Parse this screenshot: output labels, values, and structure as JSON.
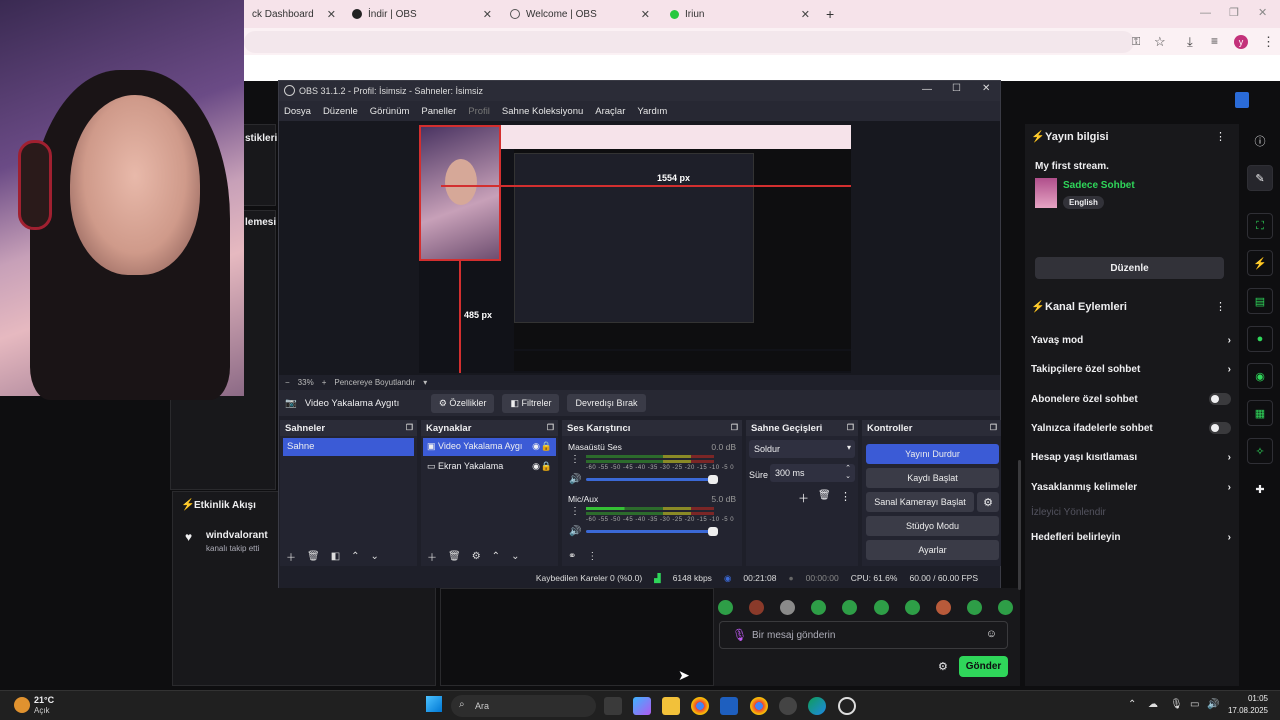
{
  "browser": {
    "tabs": [
      {
        "label": "ck Dashboard"
      },
      {
        "label": "İndir | OBS"
      },
      {
        "label": "Welcome | OBS"
      },
      {
        "label": "Iriun"
      }
    ],
    "new_tab": "+",
    "profile_initial": "y"
  },
  "twitch": {
    "left_headers": [
      "stikleri",
      "lemesi"
    ],
    "event_feed": {
      "title": "Etkinlik Akışı",
      "item_user": "windvalorant",
      "item_text": "kanalı takip etti"
    },
    "stream_info": {
      "title": "Yayın bilgisi",
      "stream_name": "My first stream.",
      "category": "Sadece Sohbet",
      "tag": "English",
      "edit_button": "Düzenle"
    },
    "channel_actions": {
      "title": "Kanal Eylemleri",
      "items": [
        {
          "label": "Yavaş mod",
          "control": "arrow"
        },
        {
          "label": "Takipçilere özel sohbet",
          "control": "arrow"
        },
        {
          "label": "Abonelere özel sohbet",
          "control": "toggle"
        },
        {
          "label": "Yalnızca ifadelerle sohbet",
          "control": "toggle"
        },
        {
          "label": "Hesap yaşı kısıtlaması",
          "control": "arrow"
        },
        {
          "label": "Yasaklanmış kelimeler",
          "control": "arrow"
        },
        {
          "label": "İzleyici Yönlendir",
          "control": "none"
        },
        {
          "label": "Hedefleri belirleyin",
          "control": "arrow"
        }
      ]
    },
    "chat": {
      "placeholder": "Bir mesaj gönderin",
      "send": "Gönder"
    }
  },
  "obs": {
    "title": "OBS 31.1.2 - Profil: İsimsiz - Sahneler: İsimsiz",
    "menu": [
      "Dosya",
      "Düzenle",
      "Görünüm",
      "Paneller",
      "Profil",
      "Sahne Koleksiyonu",
      "Araçlar",
      "Yardım"
    ],
    "preview": {
      "width_label": "1554 px",
      "height_label": "485 px"
    },
    "zoom": {
      "minus": "−",
      "value": "33%",
      "plus": "+",
      "fit": "Pencereye Boyutlandır"
    },
    "source_bar": {
      "source": "Video Yakalama Aygıtı",
      "properties": "Özellikler",
      "filters": "Filtreler",
      "deactivate": "Devredışı Bırak"
    },
    "scenes": {
      "title": "Sahneler",
      "items": [
        "Sahne"
      ]
    },
    "sources": {
      "title": "Kaynaklar",
      "items": [
        "Video Yakalama Aygı",
        "Ekran Yakalama"
      ]
    },
    "mixer": {
      "title": "Ses Karıştırıcı",
      "tracks": [
        {
          "name": "Masaüstü Ses",
          "db": "0.0 dB"
        },
        {
          "name": "Mic/Aux",
          "db": "5.0 dB"
        }
      ],
      "scale": "-60 -55 -50 -45 -40 -35 -30 -25 -20 -15 -10 -5 0"
    },
    "transitions": {
      "title": "Sahne Geçişleri",
      "type": "Soldur",
      "duration_label": "Süre",
      "duration": "300 ms"
    },
    "controls": {
      "title": "Kontroller",
      "buttons": [
        "Yayını Durdur",
        "Kaydı Başlat",
        "Sanal Kamerayı Başlat",
        "Stüdyo Modu",
        "Ayarlar"
      ]
    },
    "status": {
      "dropped": "Kaybedilen Kareler 0 (%0.0)",
      "bitrate": "6148 kbps",
      "stream_time": "00:21:08",
      "rec_time": "00:00:00",
      "cpu": "CPU: 61.6%",
      "fps": "60.00 / 60.00 FPS"
    }
  },
  "taskbar": {
    "weather_temp": "21°C",
    "weather_text": "Açık",
    "search": "Ara",
    "time": "01:05",
    "date": "17.08.2025"
  },
  "colors": {
    "twitch_green": "#2fd65a",
    "obs_accent": "#3b5bd6",
    "obs_bg": "#1e1f29"
  }
}
